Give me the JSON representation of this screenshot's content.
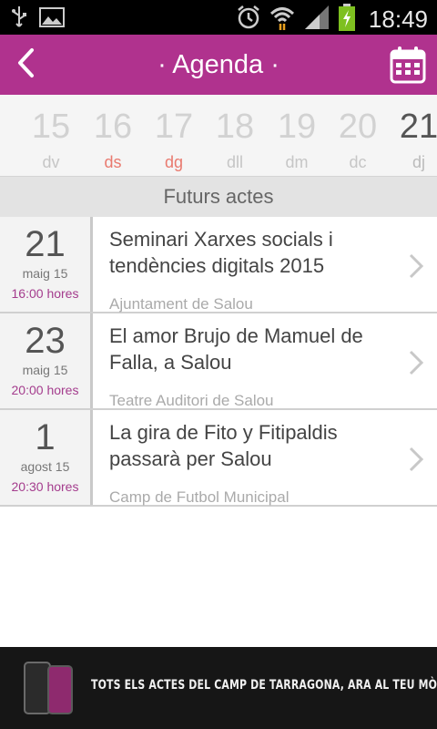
{
  "status_bar": {
    "time": "18:49",
    "icons": [
      "usb-icon",
      "image-icon",
      "alarm-icon",
      "wifi-icon",
      "signal-icon",
      "battery-charging-icon"
    ]
  },
  "header": {
    "title": "· Agenda ·",
    "back_icon": "chevron-left-icon",
    "calendar_icon": "calendar-icon",
    "color": "#b0328e"
  },
  "day_strip": [
    {
      "num": "15",
      "name": "dv"
    },
    {
      "num": "16",
      "name": "ds"
    },
    {
      "num": "17",
      "name": "dg"
    },
    {
      "num": "18",
      "name": "dll"
    },
    {
      "num": "19",
      "name": "dm"
    },
    {
      "num": "20",
      "name": "dc"
    },
    {
      "num": "21",
      "name": "dj"
    }
  ],
  "section": {
    "title": "Futurs actes"
  },
  "events": [
    {
      "day": "21",
      "month": "maig 15",
      "time": "16:00 hores",
      "title": "Seminari Xarxes socials i tendències digitals 2015",
      "place": "Ajuntament de Salou"
    },
    {
      "day": "23",
      "month": "maig 15",
      "time": "20:00 hores",
      "title": "El amor Brujo de Mamuel de Falla, a Salou",
      "place": "Teatre Auditori de Salou"
    },
    {
      "day": "1",
      "month": "agost 15",
      "time": "20:30 hores",
      "title": "La gira de Fito y Fitipaldis passarà per Salou",
      "place": "Camp de Futbol Municipal"
    }
  ],
  "banner": {
    "text": "TOTS ELS ACTES DEL CAMP DE TARRAGONA, ARA AL TEU MÒBIL"
  }
}
